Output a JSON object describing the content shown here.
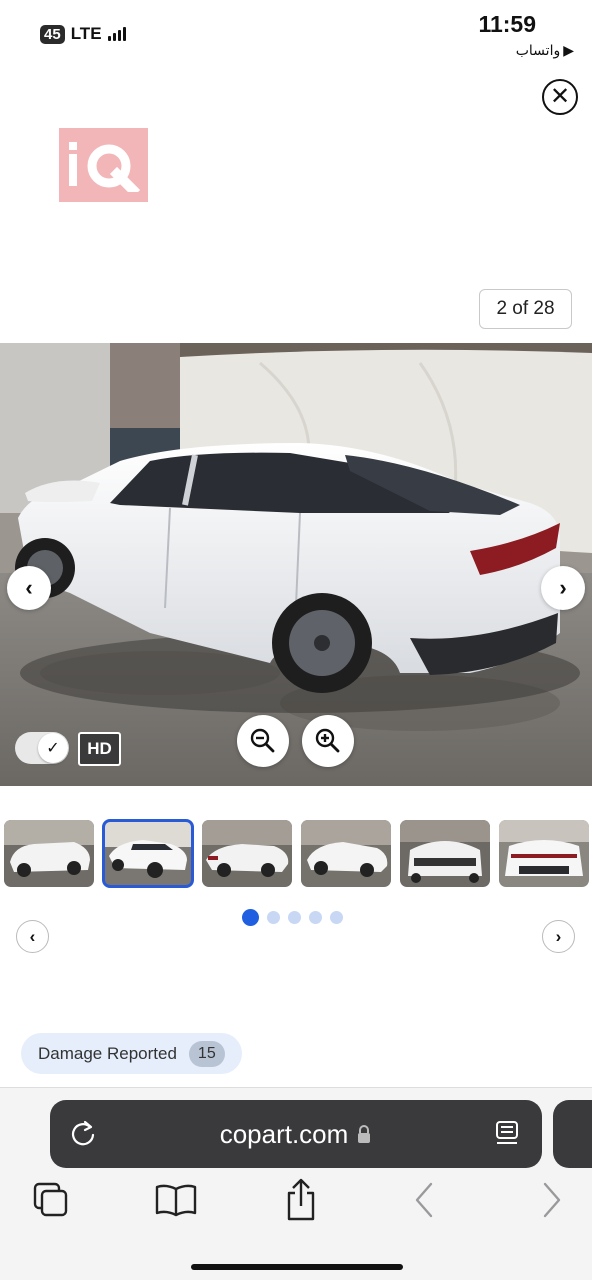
{
  "status_bar": {
    "network_badge": "45",
    "network_type": "LTE",
    "time": "11:59",
    "back_app": "واتساب"
  },
  "logo": {
    "text": "iQ"
  },
  "gallery": {
    "counter": "2 of 28",
    "hd_label": "HD",
    "hd_toggle_on": true,
    "active_thumbnail_index": 1,
    "thumbnail_count": 6,
    "page_dot_count": 5,
    "active_page_dot": 0
  },
  "damage": {
    "label": "Damage Reported",
    "count": "15"
  },
  "browser": {
    "url": "copart.com"
  },
  "icons": [
    "close-icon",
    "chevron-left-icon",
    "chevron-right-icon",
    "zoom-out-icon",
    "zoom-in-icon",
    "checkmark-icon",
    "reload-icon",
    "lock-icon",
    "reader-icon",
    "tabs-icon",
    "bookmarks-icon",
    "share-icon",
    "back-icon",
    "forward-icon"
  ],
  "colors": {
    "accent_blue": "#1f5fe0",
    "logo_bg": "#f2b6b8",
    "url_bar_bg": "#3a3a3c",
    "damage_pill_bg": "#e6eefb"
  }
}
